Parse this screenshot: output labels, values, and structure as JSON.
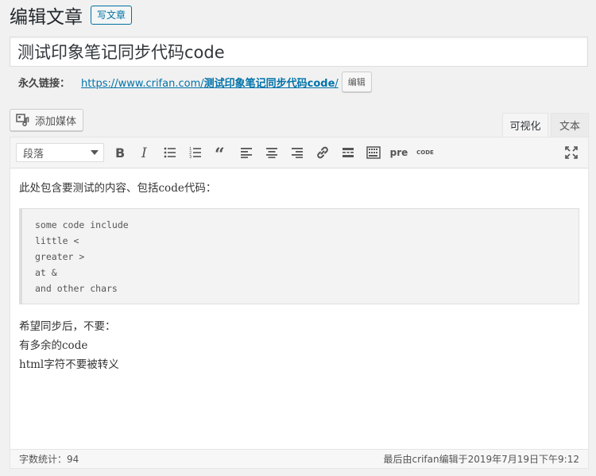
{
  "header": {
    "title": "编辑文章",
    "add_new_label": "写文章"
  },
  "post": {
    "title": "测试印象笔记同步代码code"
  },
  "permalink": {
    "label": "永久链接：",
    "url_prefix": "https://www.crifan.com/",
    "url_slug": "测试印象笔记同步代码code",
    "url_suffix": "/",
    "edit_label": "编辑"
  },
  "media": {
    "add_media_label": "添加媒体"
  },
  "tabs": {
    "visual": "可视化",
    "text": "文本"
  },
  "toolbar": {
    "format_select_value": "段落",
    "buttons": [
      "bold",
      "italic",
      "bullet-list",
      "numbered-list",
      "blockquote",
      "align-left",
      "align-center",
      "align-right",
      "link",
      "more",
      "toolbar-toggle",
      "pre",
      "code",
      "fullscreen"
    ],
    "pre_label": "pre",
    "code_label": "CODE"
  },
  "content": {
    "intro": "此处包含要测试的内容、包括code代码：",
    "code_lines": [
      "some code include",
      "little <",
      "greater >",
      "at &",
      "and other chars"
    ],
    "after_lines": [
      "希望同步后，不要：",
      "有多余的code",
      "html字符不要被转义"
    ]
  },
  "status": {
    "word_count_label": "字数统计：",
    "word_count": "94",
    "last_edited": "最后由crifan编辑于2019年7月19日下午9:12"
  },
  "colors": {
    "link": "#0073aa",
    "button_primary_border": "#0071a1"
  }
}
